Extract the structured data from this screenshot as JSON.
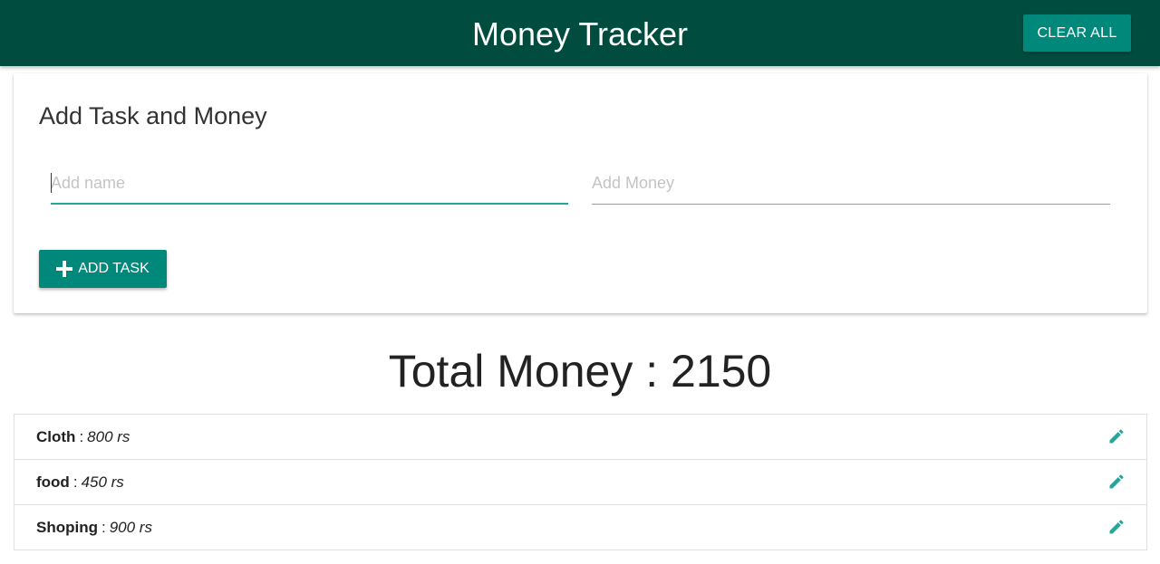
{
  "header": {
    "title": "Money Tracker",
    "clear_label": "CLEAR ALL"
  },
  "form": {
    "title": "Add Task and Money",
    "name_placeholder": "Add name",
    "money_placeholder": "Add Money",
    "add_label": "ADD TASK"
  },
  "total": {
    "text": "Total Money : 2150"
  },
  "items": [
    {
      "name": "Cloth",
      "sep": ":",
      "amount": "800 rs",
      "icon": "pencil-icon"
    },
    {
      "name": "food",
      "sep": ":",
      "amount": "450 rs",
      "icon": "pencil-icon"
    },
    {
      "name": "Shoping",
      "sep": ":",
      "amount": "900 rs",
      "icon": "pencil-icon"
    }
  ],
  "colors": {
    "navbar": "#004d40",
    "accent": "#00897b",
    "focus_underline": "#26a69a"
  }
}
